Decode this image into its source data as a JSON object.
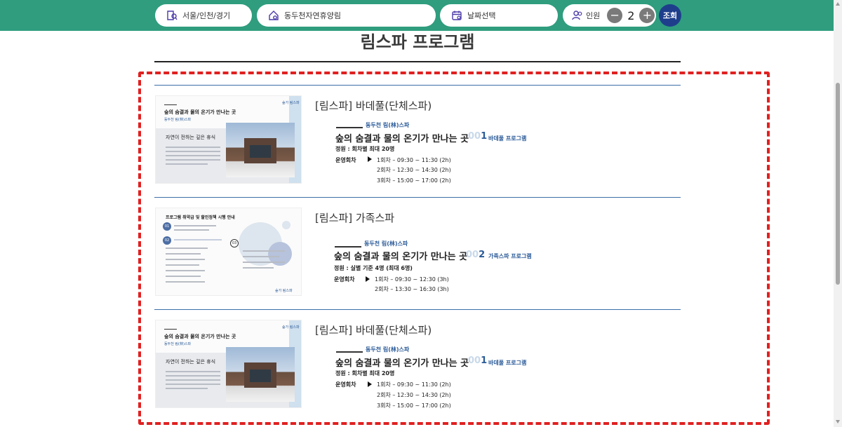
{
  "topbar": {
    "region": "서울/인천/경기",
    "place": "동두천자연휴양림",
    "date_placeholder": "날짜선택",
    "people_label": "인원",
    "people_count": "2",
    "minus": "−",
    "plus": "+",
    "search_label": "조회",
    "colors": {
      "bar": "#2f9d7e",
      "search": "#1e3e8c"
    }
  },
  "page": {
    "title": "림스파 프로그램"
  },
  "programs": [
    {
      "name": "[림스파] 바데풀(단체스파)",
      "thumb_headline": "숲의 숨결과 물의 온기가 만나는 곳",
      "thumb_sub": "동두천 림(林)스파",
      "thumb_panel_title": "자연이 전하는 깊은 휴식",
      "thumb_logo": "숲가 림스파",
      "brand": "동두천 림(林)스파",
      "headline": "숲의 숨결과 물의 온기가 만나는 곳",
      "num_prefix": "00",
      "num_suffix": "1",
      "type": "바데풀 프로그램",
      "capacity": "정원 : 회차별 최대 20명",
      "schedule_label": "운영회차",
      "schedule": [
        "1회차 – 09:30 ~ 11:30 (2h)",
        "2회차 – 12:30 ~ 14:30 (2h)",
        "3회차 – 15:00 ~ 17:00 (2h)"
      ]
    },
    {
      "name": "[림스파] 가족스파",
      "thumb_headline": "프로그램 취약급 및 할인정책 시행 안내",
      "thumb_logo": "숲가 림스파",
      "thumb_nums": [
        "01",
        "02",
        "03"
      ],
      "brand": "동두천 림(林)스파",
      "headline": "숲의 숨결과 물의 온기가 만나는 곳",
      "num_prefix": "00",
      "num_suffix": "2",
      "type": "가족스파 프로그램",
      "capacity": "정원 : 실별 기준 4명 (최대 6명)",
      "schedule_label": "운영회차",
      "schedule": [
        "1회차 – 09:30 ~ 12:30 (3h)",
        "2회차 – 13:30 ~ 16:30 (3h)"
      ]
    },
    {
      "name": "[림스파] 바데풀(단체스파)",
      "thumb_headline": "숲의 숨결과 물의 온기가 만나는 곳",
      "thumb_sub": "동두천 림(林)스파",
      "thumb_panel_title": "자연이 전하는 깊은 휴식",
      "thumb_logo": "숲가 림스파",
      "brand": "동두천 림(林)스파",
      "headline": "숲의 숨결과 물의 온기가 만나는 곳",
      "num_prefix": "00",
      "num_suffix": "1",
      "type": "바데풀 프로그램",
      "capacity": "정원 : 회차별 최대 20명",
      "schedule_label": "운영회차",
      "schedule": [
        "1회차 – 09:30 ~ 11:30 (2h)",
        "2회차 – 12:30 ~ 14:30 (2h)",
        "3회차 – 15:00 ~ 17:00 (2h)"
      ]
    }
  ]
}
